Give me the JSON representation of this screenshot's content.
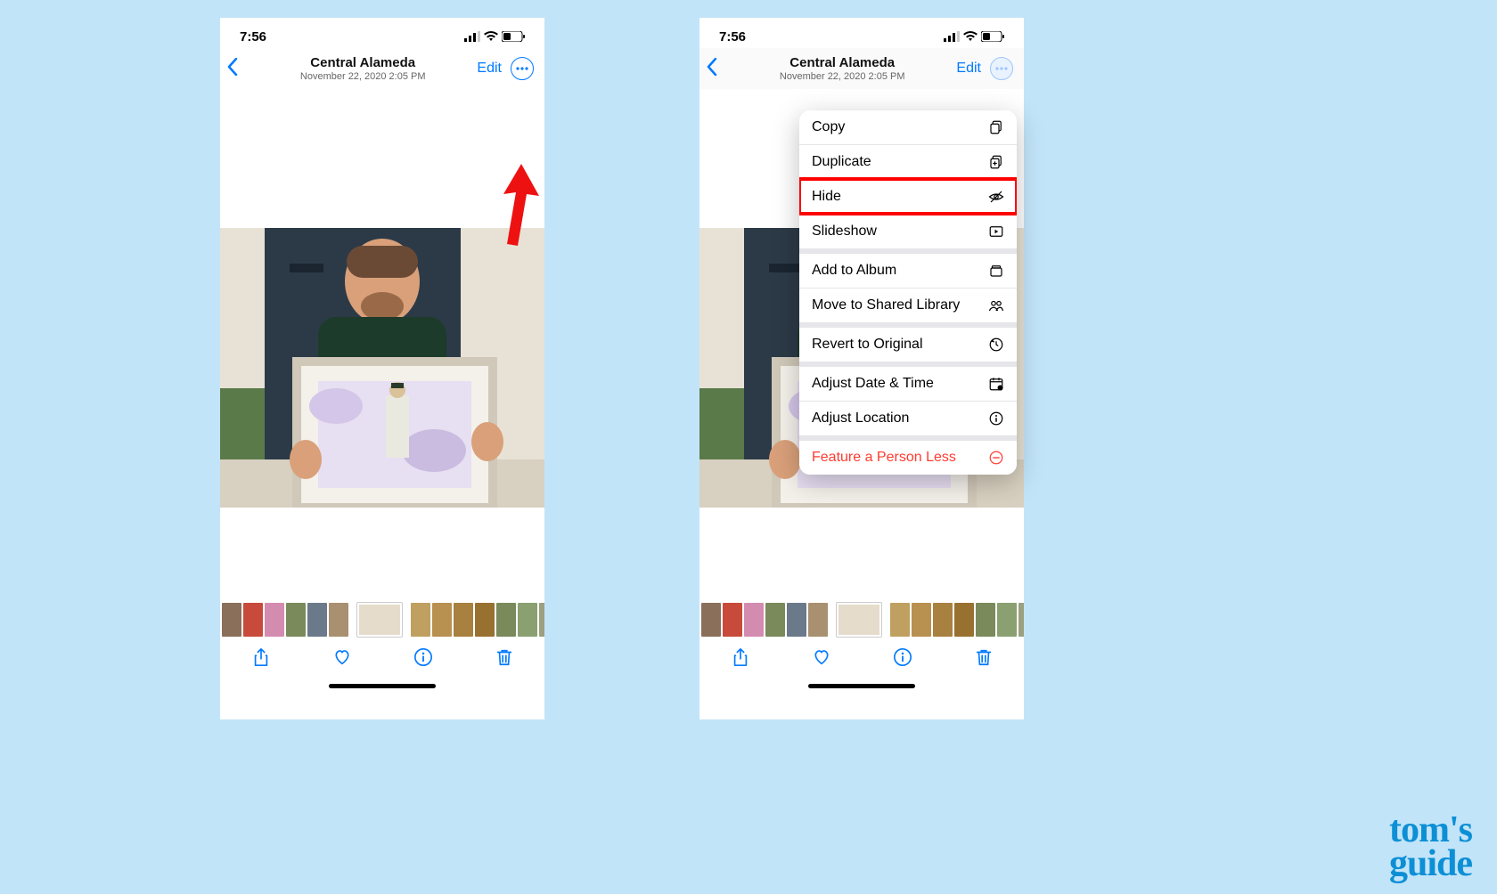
{
  "statusbar": {
    "time": "7:56"
  },
  "nav": {
    "title": "Central Alameda",
    "subtitle": "November 22, 2020  2:05 PM",
    "edit": "Edit"
  },
  "menu": {
    "group1": [
      {
        "key": "copy",
        "label": "Copy"
      },
      {
        "key": "duplicate",
        "label": "Duplicate"
      },
      {
        "key": "hide",
        "label": "Hide",
        "highlight": true
      },
      {
        "key": "slideshow",
        "label": "Slideshow"
      }
    ],
    "group2": [
      {
        "key": "addalbum",
        "label": "Add to Album"
      },
      {
        "key": "movesl",
        "label": "Move to Shared Library"
      }
    ],
    "group3": [
      {
        "key": "revert",
        "label": "Revert to Original"
      }
    ],
    "group4": [
      {
        "key": "adjdate",
        "label": "Adjust Date & Time"
      },
      {
        "key": "adjloc",
        "label": "Adjust Location"
      }
    ],
    "group5": [
      {
        "key": "feature",
        "label": "Feature a Person Less",
        "destructive": true
      }
    ]
  },
  "watermark": {
    "line1": "tom's",
    "line2": "guide"
  },
  "scrubber_thumb_colors": [
    "#8a6f5a",
    "#c74a3a",
    "#d48bb0",
    "#7a8a5a",
    "#6b7a8a",
    "#a89070",
    "#b0a080",
    "current",
    "#c0a060",
    "#b89050",
    "#a88040",
    "#987030",
    "#7a8a5a",
    "#8aa070",
    "#9aa080",
    "#a0a070",
    "#b0a060"
  ]
}
